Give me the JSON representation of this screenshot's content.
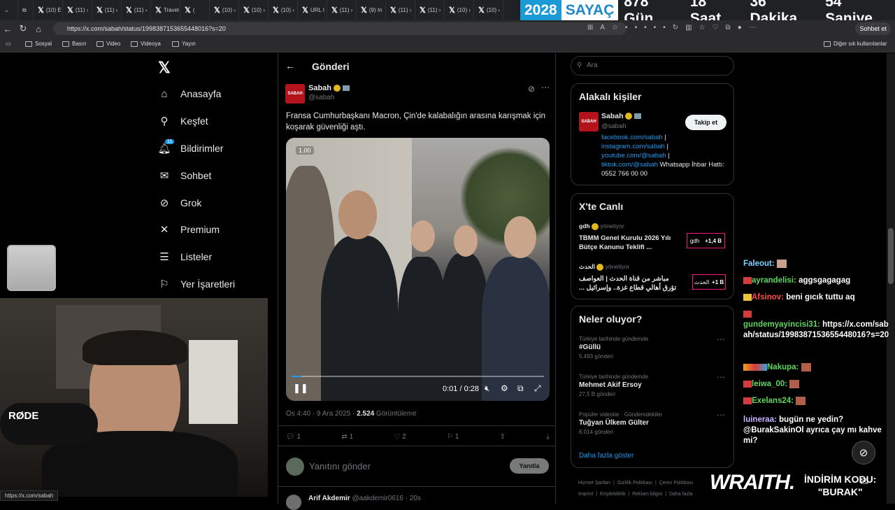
{
  "browser": {
    "tabs": [
      "(10) E",
      "(11) ›",
      "(11) ›",
      "(11) ›",
      "Travel",
      "(",
      "(10) ›",
      "(10) ›",
      "(10) ›",
      "URL I",
      "(11) ›",
      "(9) In",
      "(11) ›",
      "(11) ›",
      "(10) ›",
      "(10) ›"
    ],
    "url": "https://x.com/sabah/status/1998387153655448016?s=20",
    "chat_button": "Sohbet et",
    "bookmarks": [
      "Sosyal",
      "Basın",
      "Video",
      "Videoya",
      "Yayın"
    ],
    "bookmarks_right": "Diğer sık kullanılanlar",
    "status_url": "https://x.com/sabah"
  },
  "counter": {
    "year": "2028",
    "label": "SAYAÇ",
    "days": "878 Gün",
    "hours": "18 Saat",
    "minutes": "36 Dakika",
    "seconds": "54 Saniye"
  },
  "sidebar": {
    "items": [
      {
        "label": "Anasayfa",
        "icon": "home-icon"
      },
      {
        "label": "Keşfet",
        "icon": "search-icon"
      },
      {
        "label": "Bildirimler",
        "icon": "bell-icon",
        "badge": "11"
      },
      {
        "label": "Sohbet",
        "icon": "mail-icon"
      },
      {
        "label": "Grok",
        "icon": "grok-icon"
      },
      {
        "label": "Premium",
        "icon": "x-icon"
      },
      {
        "label": "Listeler",
        "icon": "list-icon"
      },
      {
        "label": "Yer İşaretleri",
        "icon": "bookmark-icon"
      }
    ]
  },
  "post": {
    "header_title": "Gönderi",
    "author_name": "Sabah",
    "author_handle": "@sabah",
    "avatar_text": "SABAH",
    "text": "Fransa Cumhurbaşkanı Macron, Çin'de kalabalığın arasına karışmak için koşarak güvenliği aştı.",
    "video_speed": "1.00",
    "video_time": "0:01 / 0:28",
    "video_progress": 0.04,
    "meta_time": "Ös 4:40 · 9 Ara 2025 · ",
    "views": "2.524",
    "views_label": " Görüntüleme",
    "replies": "1",
    "reposts": "1",
    "likes": "2",
    "bookmarks": "1",
    "reply_placeholder": "Yanıtını gönder",
    "reply_button": "Yanıtla",
    "next_author": "Arif Akdemir",
    "next_handle": "@aakdemir0616 · 20s"
  },
  "right": {
    "search_placeholder": "Ara",
    "related_title": "Alakalı kişiler",
    "related_name": "Sabah",
    "related_handle": "@sabah",
    "follow_button": "Takip et",
    "bio_links": [
      "facebook.com/sabah",
      "instagram.com/sabah",
      "youtube.com/@sabah",
      "tiktok.com/@sabah"
    ],
    "bio_tail": "Whatsapp İhbar Hattı: 0552 766 00 00",
    "live_title": "X'te Canlı",
    "live": [
      {
        "host": "gdh",
        "role": "yönetiyor",
        "title": "TBMM Genel Kurulu 2026 Yılı Bütçe Kanunu Teklifi ...",
        "badge": "gdh",
        "count": "+1,4 B"
      },
      {
        "host": "الحدث",
        "role": "yönetiyor",
        "title": "مباشر من قناة الحدث | العواصف تؤرق أهالي قطاع غزة.. وإسرائيل ...",
        "badge": "الحدث",
        "count": "+1 B"
      }
    ],
    "trends_title": "Neler oluyor?",
    "trends": [
      {
        "context": "Türkiye tarihinde gündemde",
        "name": "#Güllü",
        "count": "5.493 gönderi"
      },
      {
        "context": "Türkiye tarihinde gündemde",
        "name": "Mehmet Akif Ersoy",
        "count": "27,5 B gönderi"
      },
      {
        "context": "Popüler videolar · Gündemdekiler",
        "name": "Tuğyan Ülkem Gülter",
        "count": "6.014 gönderi"
      }
    ],
    "show_more": "Daha fazla göster",
    "footer": [
      "Hizmet Şartları",
      "Gizlilik Politikası",
      "Çerez Politikası",
      "Imprint",
      "Erişilebilirlik",
      "Reklam bilgisi",
      "Daha fazla"
    ]
  },
  "chat": [
    {
      "user": "Faleout:",
      "msg": "",
      "color": "#7ad0ff"
    },
    {
      "user": "ayrandelisi:",
      "msg": "aggsgagagag",
      "color": "#5ed65e"
    },
    {
      "user": "Afsinov:",
      "msg": "beni gıcık tuttu aq",
      "color": "#ff4a4a"
    },
    {
      "user": "gundemyayincisi31:",
      "msg": "https://x.com/sabah/status/1998387153655448016?s=20",
      "color": "#5ed65e"
    },
    {
      "user": "Nakupa:",
      "msg": "",
      "color": "#5ed65e"
    },
    {
      "user": "leiwa_00:",
      "msg": "",
      "color": "#5ed65e"
    },
    {
      "user": "Exelans24:",
      "msg": "",
      "color": "#5ed65e"
    },
    {
      "user": "luineraa:",
      "msg": "bugün ne yedin? @BurakSakinOl ayrıca çay mı kahve mi?",
      "color": "#c7b3ff"
    }
  ],
  "overlay": {
    "brand": "WRAITH.",
    "promo_line1": "İNDİRİM KODU:",
    "promo_line2": "\"BURAK\"",
    "mic_brand": "RØDE"
  },
  "colors": {
    "accent": "#1d9bf0",
    "live_border": "#f91880",
    "counter_blue": "#1c9ad6"
  }
}
